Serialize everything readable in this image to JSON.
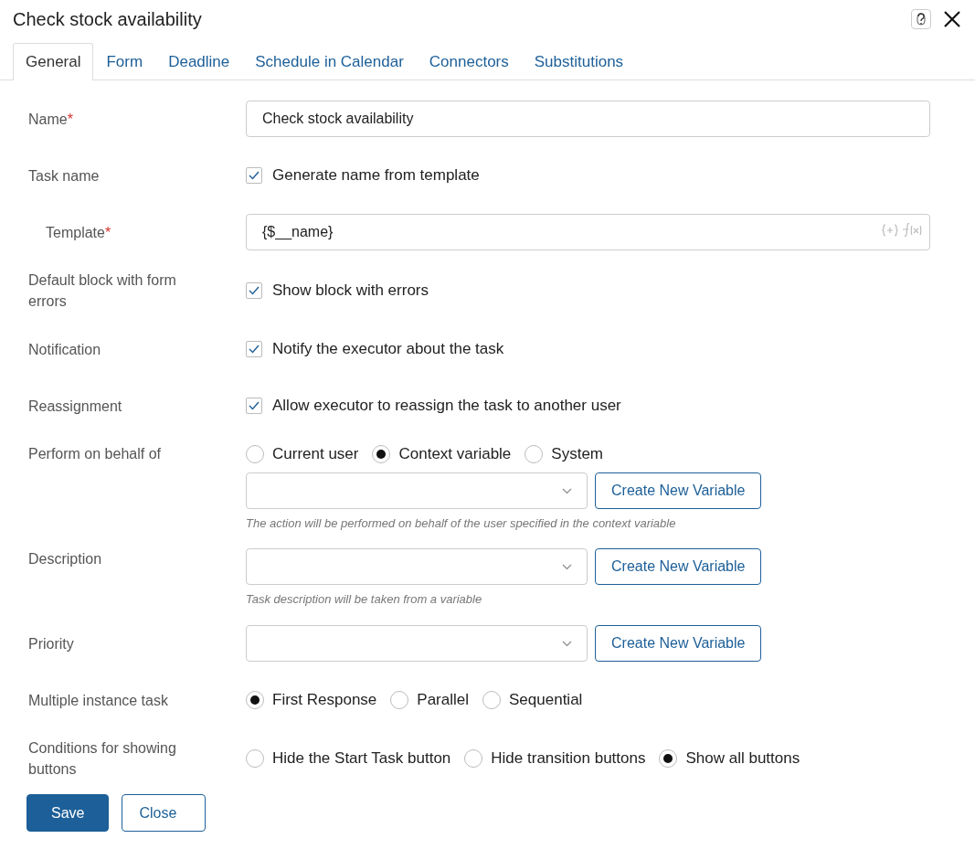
{
  "window": {
    "title": "Check stock availability"
  },
  "tabs": [
    {
      "label": "General",
      "selected": true
    },
    {
      "label": "Form",
      "selected": false
    },
    {
      "label": "Deadline",
      "selected": false
    },
    {
      "label": "Schedule in Calendar",
      "selected": false
    },
    {
      "label": "Connectors",
      "selected": false
    },
    {
      "label": "Substitutions",
      "selected": false
    }
  ],
  "rows": [
    {
      "label": "Name",
      "required_mark": "*",
      "indented": false,
      "controls": [
        {
          "kind": "text",
          "value": "Check stock availability"
        }
      ]
    },
    {
      "label": "Task  name",
      "indented": false,
      "controls": [
        {
          "kind": "checkbox",
          "label": "Generate name from template",
          "checked": true
        }
      ]
    },
    {
      "label": "Template",
      "required_mark": "*",
      "indented": true,
      "controls": [
        {
          "kind": "template",
          "value": "{$__name}"
        }
      ]
    },
    {
      "label": "Default block with form errors",
      "indented": false,
      "controls": [
        {
          "kind": "checkbox",
          "label": "Show block with errors",
          "checked": true
        }
      ]
    },
    {
      "label": "Notification",
      "indented": false,
      "controls": [
        {
          "kind": "checkbox",
          "label": "Notify the executor about the task",
          "checked": true
        }
      ]
    },
    {
      "label": "Reassignment",
      "indented": false,
      "controls": [
        {
          "kind": "checkbox",
          "label": "Allow executor to reassign the task to another user",
          "checked": true
        }
      ]
    },
    {
      "label": "Perform on behalf of",
      "indented": false,
      "controls": [
        {
          "kind": "radio",
          "options": [
            {
              "label": "Current user",
              "selected": false
            },
            {
              "label": "Context variable",
              "selected": true
            },
            {
              "label": "System",
              "selected": false
            }
          ]
        },
        {
          "kind": "select",
          "button": "Create New Variable",
          "hint": "The action will be performed on behalf of the user specified in the context variable"
        }
      ]
    },
    {
      "label": "Description",
      "indented": false,
      "controls": [
        {
          "kind": "select",
          "button": "Create New Variable",
          "hint": "Task description will be taken from a variable"
        }
      ]
    },
    {
      "label": "Priority",
      "indented": false,
      "controls": [
        {
          "kind": "select",
          "button": "Create New Variable"
        }
      ]
    },
    {
      "label": "Multiple instance task",
      "indented": false,
      "controls": [
        {
          "kind": "radio",
          "options": [
            {
              "label": "First Response",
              "selected": true
            },
            {
              "label": "Parallel",
              "selected": false
            },
            {
              "label": "Sequential",
              "selected": false
            }
          ]
        }
      ]
    },
    {
      "label": "Conditions for showing buttons",
      "indented": false,
      "controls": [
        {
          "kind": "radio",
          "options": [
            {
              "label": "Hide the Start Task button",
              "selected": false
            },
            {
              "label": "Hide transition buttons",
              "selected": false
            },
            {
              "label": "Show all buttons",
              "selected": true
            }
          ]
        }
      ]
    }
  ],
  "footer": {
    "buttons": [
      {
        "label": "Save",
        "kind": "primary"
      },
      {
        "label": "Close",
        "kind": "secondary"
      }
    ]
  }
}
